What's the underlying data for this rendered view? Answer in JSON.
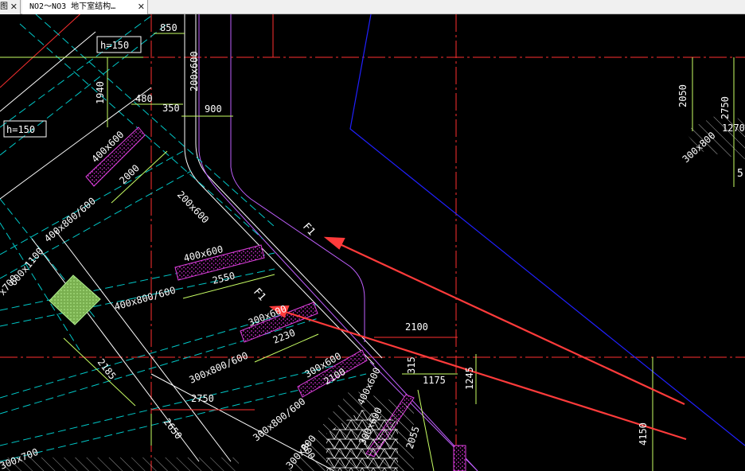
{
  "tabs": [
    {
      "label": "图",
      "active": false
    },
    {
      "label": "NO2～NO3 地下室结构…",
      "active": true
    }
  ],
  "drawing": {
    "background": "#000000",
    "colors": {
      "dimension": "#c8ff64",
      "axis": "#ff3030",
      "wall": "#ffffff",
      "beam_dash": "#00c8c8",
      "hatch": "#c020c0",
      "outline": "#2020ff",
      "contour": "#c060ff",
      "annotation_arrow": "#ff3b3b",
      "pile_cap": "#a0e080"
    },
    "tags": [
      "h=150",
      "h=150"
    ],
    "dims": [
      "850",
      "1940",
      "480",
      "350",
      "900",
      "2000",
      "2550",
      "2230",
      "2185",
      "2750",
      "2650",
      "2100",
      "2100",
      "315",
      "1175",
      "1245",
      "2055",
      "800",
      "2050",
      "2750",
      "1270",
      "4150"
    ],
    "beam_labels": [
      "200x600",
      "400x600",
      "200x600",
      "400x800/600",
      "400x600",
      "400x800/600",
      "300x600",
      "300x800/600",
      "300x600",
      "300x800/600",
      "400x600",
      "300x800",
      "300x600",
      "600x1100",
      "x700",
      "300x700",
      "300x800"
    ],
    "markers": [
      "F1",
      "F1"
    ],
    "tail_texts": [
      "5"
    ]
  }
}
